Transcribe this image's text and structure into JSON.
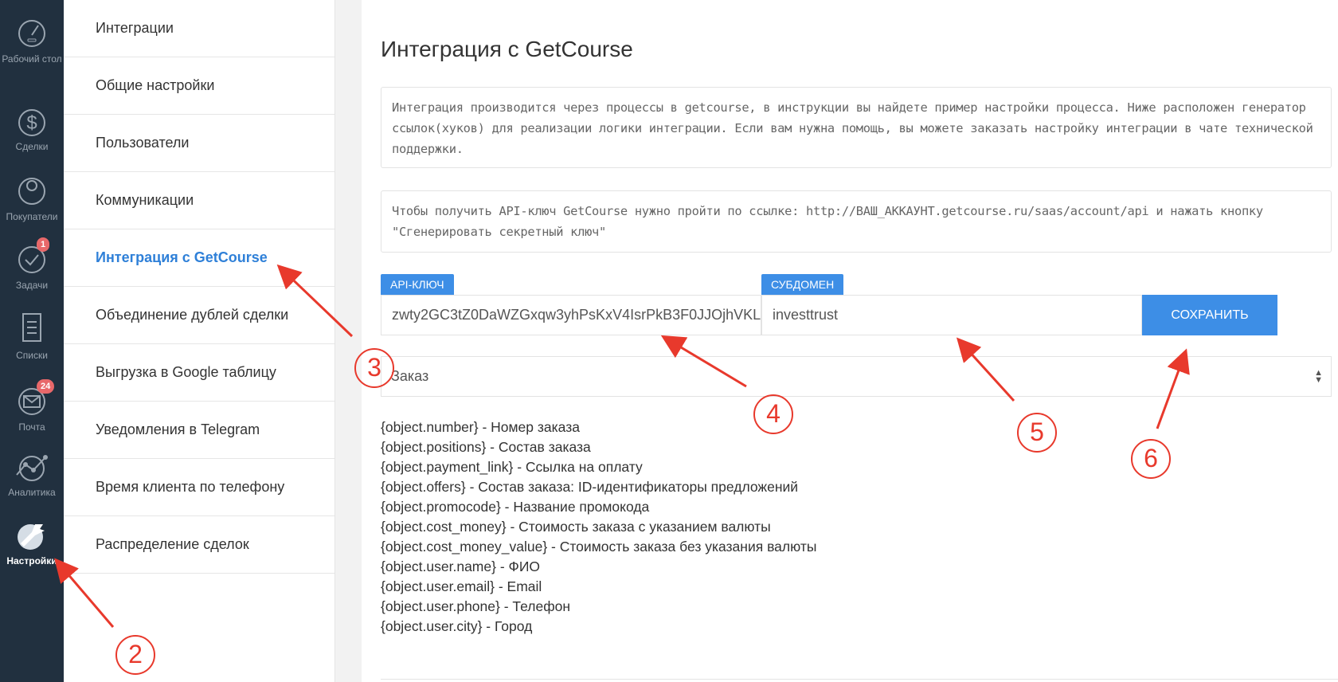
{
  "nav": [
    {
      "label": "Рабочий стол",
      "icon": "dashboard-icon"
    },
    {
      "label": "Сделки",
      "icon": "dollar-icon"
    },
    {
      "label": "Покупатели",
      "icon": "customers-icon"
    },
    {
      "label": "Задачи",
      "icon": "tasks-icon",
      "badge": "1"
    },
    {
      "label": "Списки",
      "icon": "lists-icon"
    },
    {
      "label": "Почта",
      "icon": "mail-icon",
      "badge": "24"
    },
    {
      "label": "Аналитика",
      "icon": "analytics-icon"
    },
    {
      "label": "Настройки",
      "icon": "wrench-icon",
      "active": true
    }
  ],
  "menu": [
    "Интеграции",
    "Общие настройки",
    "Пользователи",
    "Коммуникации",
    "Интеграция с GetCourse",
    "Объединение дублей сделки",
    "Выгрузка в Google таблицу",
    "Уведомления в Telegram",
    "Время клиента по телефону",
    "Распределение сделок"
  ],
  "main": {
    "title": "Интеграция с GetCourse",
    "info1": "Интеграция производится через процессы в getcourse, в инструкции вы найдете пример настройки процесса. Ниже расположен генератор ссылок(хуков) для реализации логики интеграции. Если вам нужна помощь, вы можете заказать настройку интеграции в чате технической поддержки.",
    "info2": "Чтобы получить API-ключ GetCourse нужно пройти по ссылке: http://ВАШ_АККАУНТ.getcourse.ru/saas/account/api и нажать кнопку \"Сгенерировать секретный ключ\"",
    "api_label": "API-КЛЮЧ",
    "api_value": "zwty2GC3tZ0DaWZGxqw3yhPsKxV4IsrPkB3F0JJOjhVKL",
    "sub_label": "СУБДОМЕН",
    "sub_value": "investtrust",
    "save": "СОХРАНИТЬ",
    "select": "Заказ",
    "vars": [
      "{object.number} - Номер заказа",
      "{object.positions} - Состав заказа",
      "{object.payment_link} - Ссылка на оплату",
      "{object.offers} - Состав заказа: ID-идентификаторы предложений",
      "{object.promocode} - Название промокода",
      "{object.cost_money} - Стоимость заказа с указанием валюты",
      "{object.cost_money_value} - Стоимость заказа без указания валюты",
      "{object.user.name} - ФИО",
      "{object.user.email} - Email",
      "{object.user.phone} - Телефон",
      "{object.user.city} - Город"
    ]
  },
  "annotations": [
    "2",
    "3",
    "4",
    "5",
    "6"
  ],
  "colors": {
    "accent": "#3d8ee6",
    "sidebar": "#21303f",
    "annotation": "#e8392c"
  }
}
